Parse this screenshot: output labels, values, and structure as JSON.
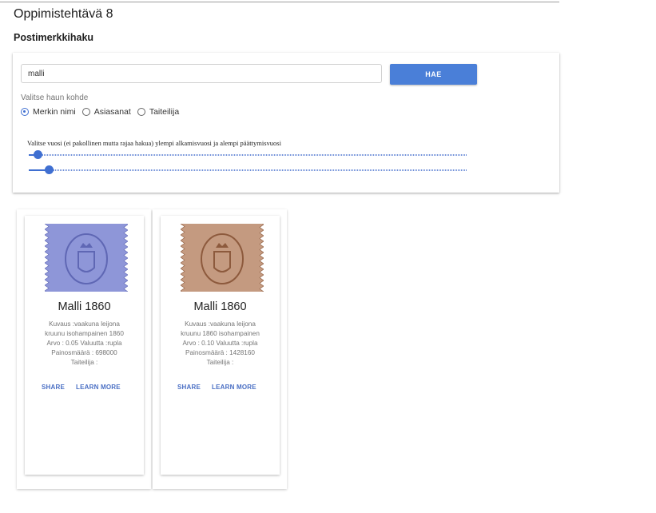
{
  "app": {
    "title": "Oppimistehtävä 8"
  },
  "section": {
    "title": "Postimerkkihaku"
  },
  "search": {
    "value": "malli",
    "button_label": "HAE",
    "target_label": "Valitse haun kohde",
    "options": [
      {
        "label": "Merkin nimi",
        "checked": true
      },
      {
        "label": "Asiasanat",
        "checked": false
      },
      {
        "label": "Taiteilija",
        "checked": false
      }
    ],
    "slider_caption": "Valitse vuosi (ei pakollinen mutta rajaa hakua) ylempi alkamisvuosi ja alempi päättymisvuosi",
    "start_year_level": 0.02,
    "end_year_level": 0.045
  },
  "results": [
    {
      "title": "Malli 1860",
      "desc": [
        "Kuvaus :vaakuna leijona",
        "kruunu isohampainen 1860",
        "Arvo : 0.05 Valuutta :rupla",
        "Painosmäärä : 698000",
        "Taiteilija :"
      ],
      "share": "SHARE",
      "learn_more": "LEARN MORE",
      "stamp_color": "#8e96d8",
      "stamp_dark": "#5f67b4"
    },
    {
      "title": "Malli 1860",
      "desc": [
        "Kuvaus :vaakuna leijona",
        "kruunu 1860 isohampainen",
        "Arvo : 0.10 Valuutta :rupla",
        "Painosmäärä : 1428160",
        "Taiteilija :"
      ],
      "share": "SHARE",
      "learn_more": "LEARN MORE",
      "stamp_color": "#c49a80",
      "stamp_dark": "#8d5a3d"
    }
  ]
}
